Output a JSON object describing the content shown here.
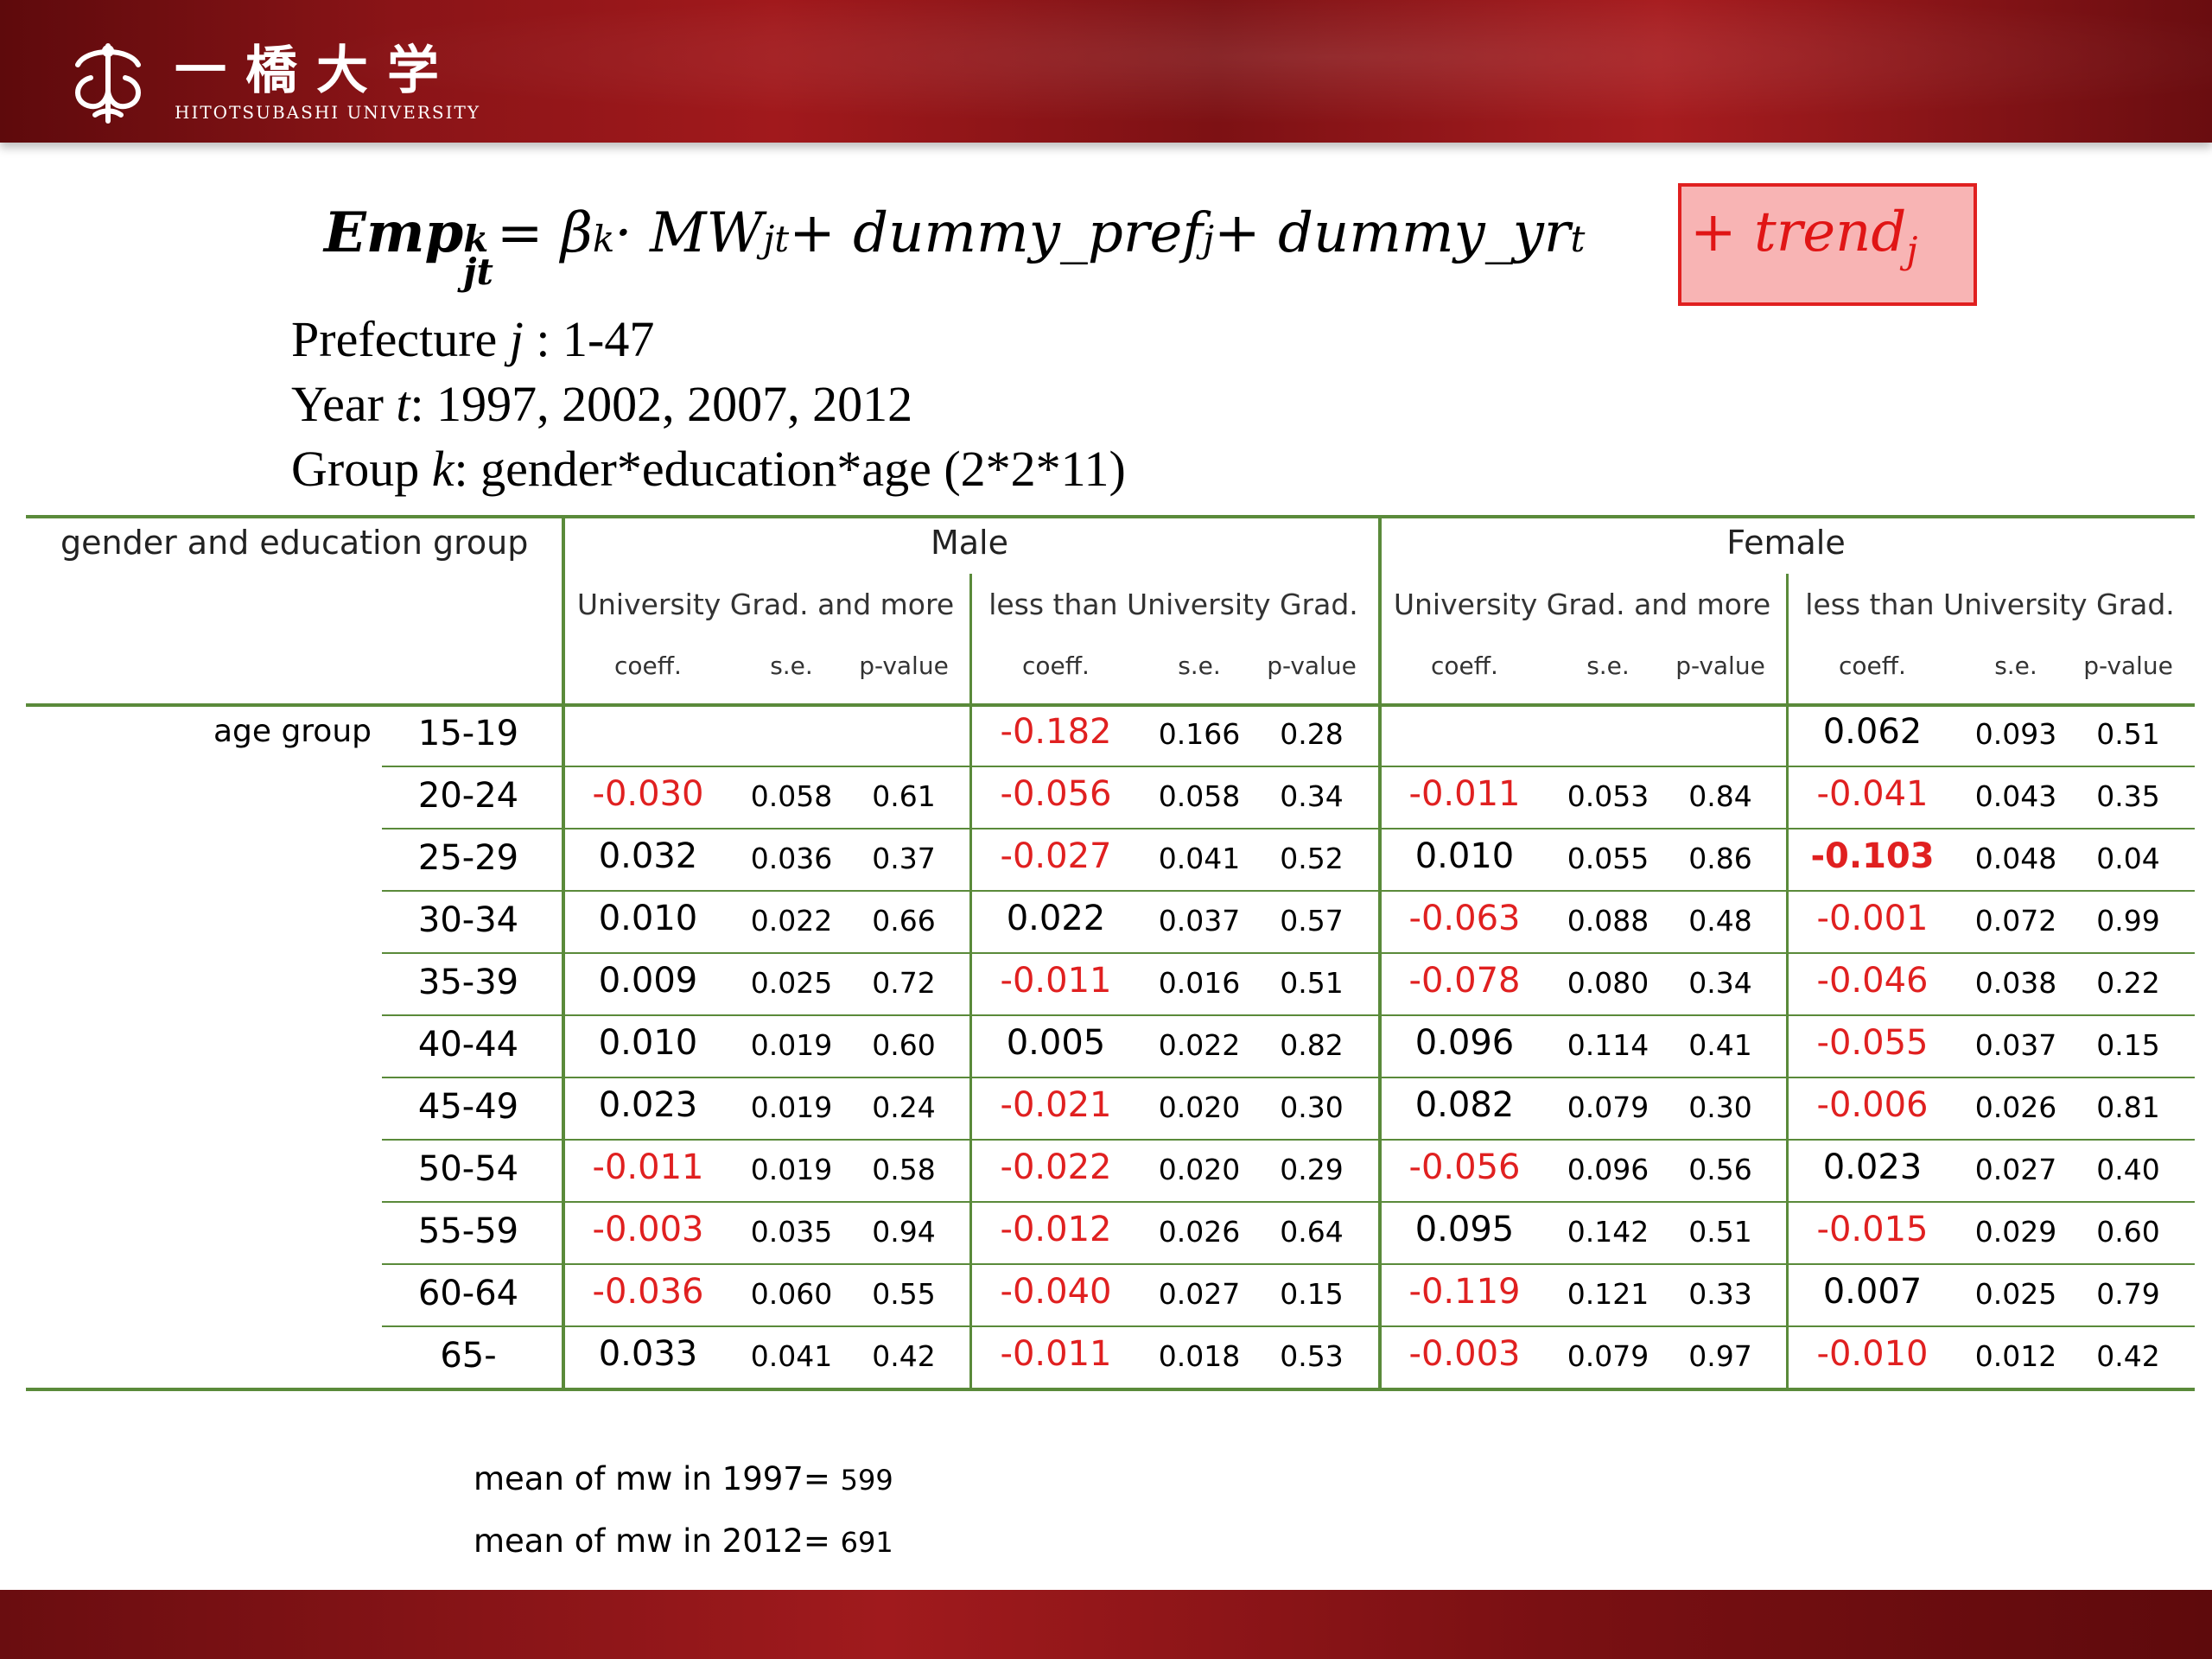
{
  "header": {
    "logo_jp": "一橋大学",
    "logo_en": "HITOTSUBASHI UNIVERSITY"
  },
  "equation": {
    "lhs": "Emp",
    "lhs_sup": "k",
    "lhs_sub": "jt",
    "eq": " = β",
    "beta_sup": "k",
    "mw": " · MW",
    "mw_sub": "jt",
    "pref": " + dummy_pref",
    "pref_sub": "j",
    "yr": " + dummy_yr",
    "yr_sub": "t",
    "trend": "+ trend",
    "trend_sub": "j"
  },
  "description": {
    "line1_a": "Prefecture ",
    "line1_var": "j",
    "line1_b": " : 1-47",
    "line2_a": "Year ",
    "line2_var": "t",
    "line2_b": ": 1997, 2002, 2007, 2012",
    "line3_a": "Group ",
    "line3_var": "k",
    "line3_b": ": gender*education*age  (2*2*11)"
  },
  "table": {
    "corner_label": "gender and education group",
    "gender_groups": [
      "Male",
      "Female"
    ],
    "education_groups": [
      "University Grad. and more",
      "less than University Grad.",
      "University Grad. and more",
      "less than University Grad."
    ],
    "stat_headers": [
      "coeff.",
      "s.e.",
      "p-value"
    ],
    "row_label": "age group",
    "rows": [
      {
        "age": "15-19",
        "cells": [
          [
            "",
            "",
            ""
          ],
          [
            "-0.182",
            "0.166",
            "0.28"
          ],
          [
            "",
            "",
            ""
          ],
          [
            "0.062",
            "0.093",
            "0.51"
          ]
        ]
      },
      {
        "age": "20-24",
        "cells": [
          [
            "-0.030",
            "0.058",
            "0.61"
          ],
          [
            "-0.056",
            "0.058",
            "0.34"
          ],
          [
            "-0.011",
            "0.053",
            "0.84"
          ],
          [
            "-0.041",
            "0.043",
            "0.35"
          ]
        ]
      },
      {
        "age": "25-29",
        "cells": [
          [
            "0.032",
            "0.036",
            "0.37"
          ],
          [
            "-0.027",
            "0.041",
            "0.52"
          ],
          [
            "0.010",
            "0.055",
            "0.86"
          ],
          [
            "-0.103",
            "0.048",
            "0.04"
          ]
        ]
      },
      {
        "age": "30-34",
        "cells": [
          [
            "0.010",
            "0.022",
            "0.66"
          ],
          [
            "0.022",
            "0.037",
            "0.57"
          ],
          [
            "-0.063",
            "0.088",
            "0.48"
          ],
          [
            "-0.001",
            "0.072",
            "0.99"
          ]
        ]
      },
      {
        "age": "35-39",
        "cells": [
          [
            "0.009",
            "0.025",
            "0.72"
          ],
          [
            "-0.011",
            "0.016",
            "0.51"
          ],
          [
            "-0.078",
            "0.080",
            "0.34"
          ],
          [
            "-0.046",
            "0.038",
            "0.22"
          ]
        ]
      },
      {
        "age": "40-44",
        "cells": [
          [
            "0.010",
            "0.019",
            "0.60"
          ],
          [
            "0.005",
            "0.022",
            "0.82"
          ],
          [
            "0.096",
            "0.114",
            "0.41"
          ],
          [
            "-0.055",
            "0.037",
            "0.15"
          ]
        ]
      },
      {
        "age": "45-49",
        "cells": [
          [
            "0.023",
            "0.019",
            "0.24"
          ],
          [
            "-0.021",
            "0.020",
            "0.30"
          ],
          [
            "0.082",
            "0.079",
            "0.30"
          ],
          [
            "-0.006",
            "0.026",
            "0.81"
          ]
        ]
      },
      {
        "age": "50-54",
        "cells": [
          [
            "-0.011",
            "0.019",
            "0.58"
          ],
          [
            "-0.022",
            "0.020",
            "0.29"
          ],
          [
            "-0.056",
            "0.096",
            "0.56"
          ],
          [
            "0.023",
            "0.027",
            "0.40"
          ]
        ]
      },
      {
        "age": "55-59",
        "cells": [
          [
            "-0.003",
            "0.035",
            "0.94"
          ],
          [
            "-0.012",
            "0.026",
            "0.64"
          ],
          [
            "0.095",
            "0.142",
            "0.51"
          ],
          [
            "-0.015",
            "0.029",
            "0.60"
          ]
        ]
      },
      {
        "age": "60-64",
        "cells": [
          [
            "-0.036",
            "0.060",
            "0.55"
          ],
          [
            "-0.040",
            "0.027",
            "0.15"
          ],
          [
            "-0.119",
            "0.121",
            "0.33"
          ],
          [
            "0.007",
            "0.025",
            "0.79"
          ]
        ]
      },
      {
        "age": "65-",
        "cells": [
          [
            "0.033",
            "0.041",
            "0.42"
          ],
          [
            "-0.011",
            "0.018",
            "0.53"
          ],
          [
            "-0.003",
            "0.079",
            "0.97"
          ],
          [
            "-0.010",
            "0.012",
            "0.42"
          ]
        ]
      }
    ],
    "highlight_bold": [
      {
        "row": 2,
        "group": 3
      }
    ],
    "negative_color": "#e02020",
    "line_color": "#5a8a3a"
  },
  "notes": [
    {
      "label": "mean of mw in 1997=",
      "value": "599"
    },
    {
      "label": "mean of mw in 2012=",
      "value": "691"
    }
  ],
  "colors": {
    "header_red": "#a1191c",
    "trend_box_fill": "#f8b4b4",
    "trend_box_border": "#e02020"
  }
}
